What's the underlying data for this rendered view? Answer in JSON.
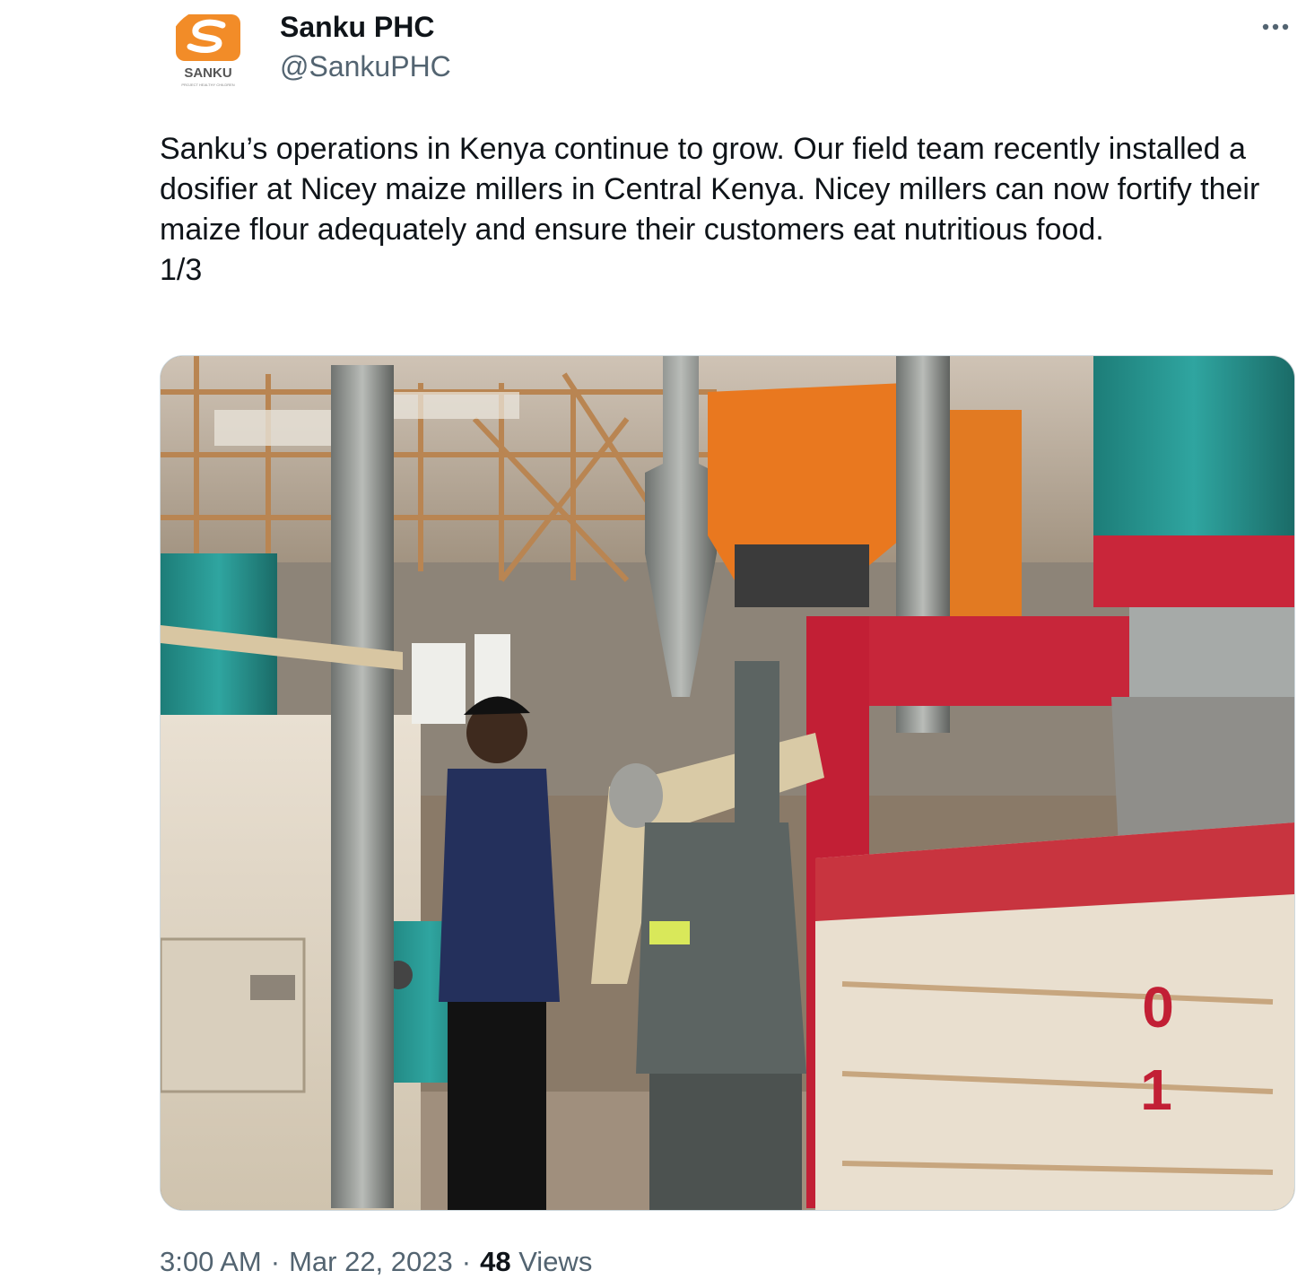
{
  "author": {
    "display_name": "Sanku PHC",
    "handle": "@SankuPHC",
    "avatar_logo_text": "SANKU",
    "avatar_logo_subtext": "PROJECT HEALTHY CHILDREN"
  },
  "tweet": {
    "text": "Sanku’s operations in Kenya continue to grow. Our field team recently installed a dosifier at Nicey maize millers in Central Kenya. Nicey millers can now fortify their maize flour adequately and ensure their customers eat nutritious food.\n1/3"
  },
  "meta": {
    "time": "3:00 AM",
    "separator": "·",
    "date": "Mar 22, 2023",
    "views_count": "48",
    "views_label": "Views"
  },
  "media": {
    "machine_digits": [
      "0",
      "1"
    ]
  },
  "icons": {
    "more": "more-options-icon"
  },
  "colors": {
    "text_primary": "#0f1419",
    "text_secondary": "#536471",
    "border": "#cfd9de",
    "brand_orange": "#f28c28"
  }
}
